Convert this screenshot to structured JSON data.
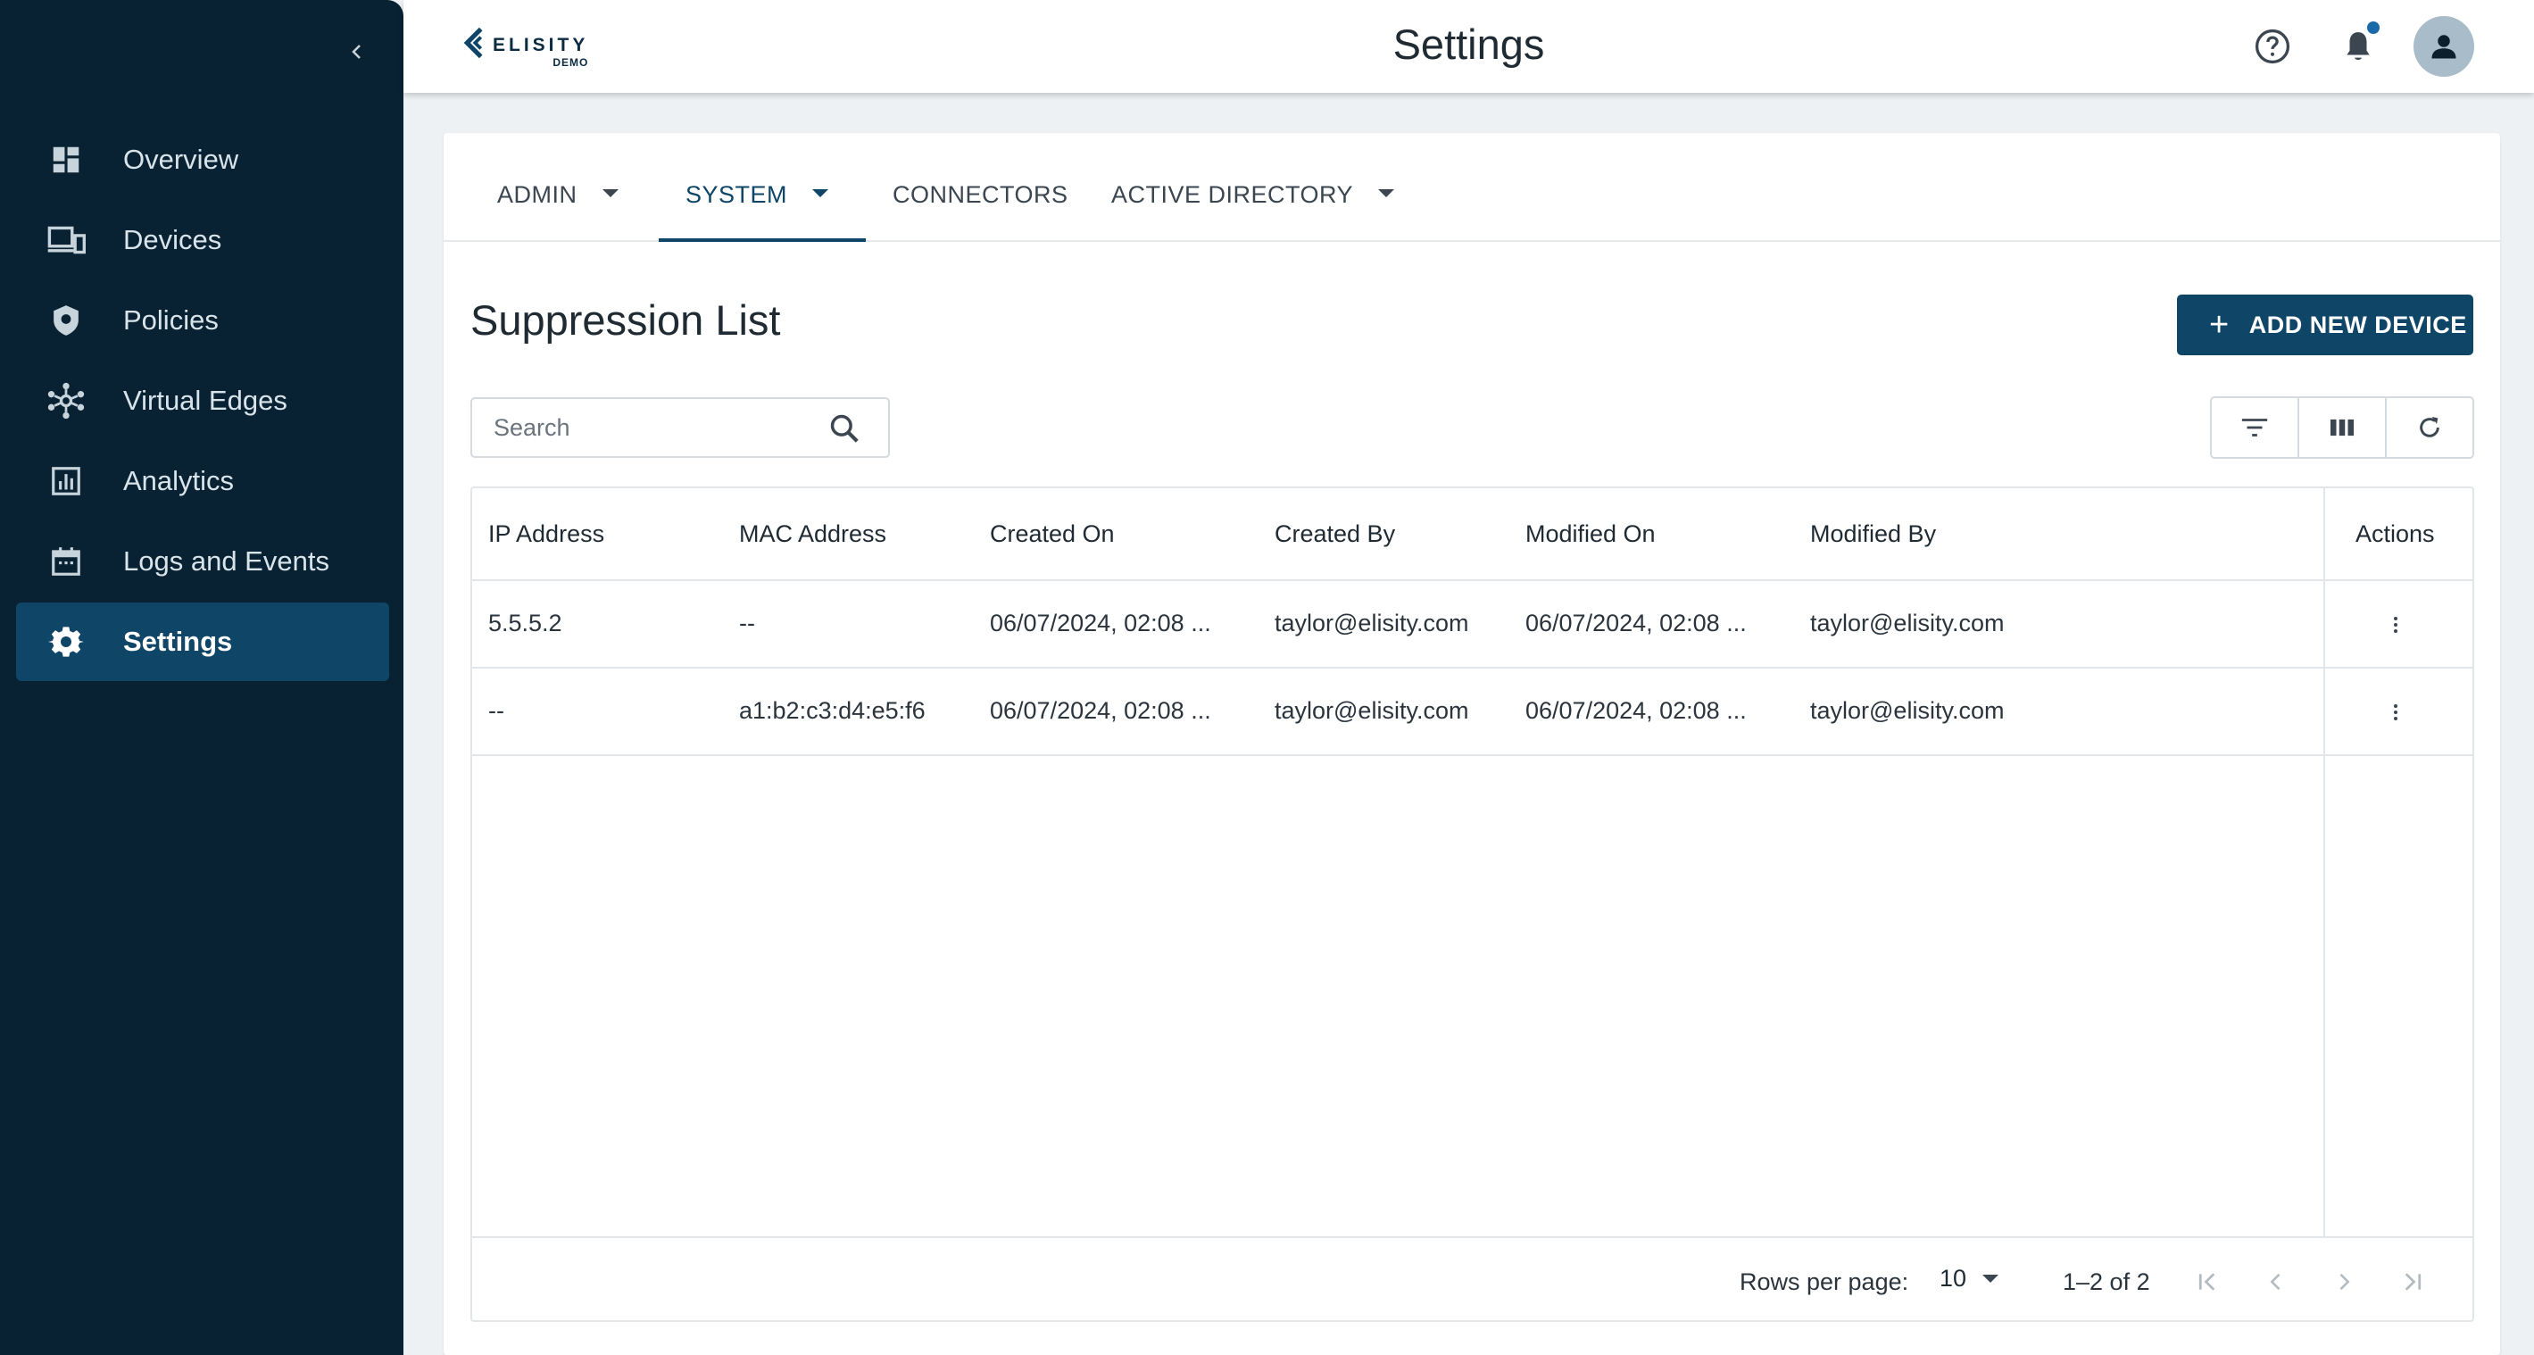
{
  "sidebar": {
    "items": [
      {
        "label": "Overview",
        "icon": "dashboard-icon"
      },
      {
        "label": "Devices",
        "icon": "devices-icon"
      },
      {
        "label": "Policies",
        "icon": "shield-icon"
      },
      {
        "label": "Virtual Edges",
        "icon": "network-icon"
      },
      {
        "label": "Analytics",
        "icon": "analytics-icon"
      },
      {
        "label": "Logs and Events",
        "icon": "calendar-icon"
      },
      {
        "label": "Settings",
        "icon": "gear-icon",
        "active": true
      }
    ]
  },
  "header": {
    "logo_text": "ELISITY",
    "logo_sub": "DEMO",
    "title": "Settings"
  },
  "tabs": [
    {
      "label": "ADMIN",
      "dropdown": true
    },
    {
      "label": "SYSTEM",
      "dropdown": true,
      "active": true
    },
    {
      "label": "CONNECTORS",
      "dropdown": false
    },
    {
      "label": "ACTIVE DIRECTORY",
      "dropdown": true
    }
  ],
  "main": {
    "title": "Suppression List",
    "add_button": "ADD NEW DEVICE",
    "search_placeholder": "Search"
  },
  "table": {
    "columns": [
      "IP Address",
      "MAC Address",
      "Created On",
      "Created By",
      "Modified On",
      "Modified By",
      "Actions"
    ],
    "rows": [
      [
        "5.5.5.2",
        "--",
        "06/07/2024, 02:08 ...",
        "taylor@elisity.com",
        "06/07/2024, 02:08 ...",
        "taylor@elisity.com"
      ],
      [
        "--",
        "a1:b2:c3:d4:e5:f6",
        "06/07/2024, 02:08 ...",
        "taylor@elisity.com",
        "06/07/2024, 02:08 ...",
        "taylor@elisity.com"
      ]
    ]
  },
  "pagination": {
    "rows_per_page_label": "Rows per page:",
    "rows_per_page": "10",
    "range": "1–2 of 2"
  },
  "colors": {
    "sidebar_bg": "#082233",
    "accent": "#0f4567",
    "notification_dot": "#1a6aa8"
  }
}
